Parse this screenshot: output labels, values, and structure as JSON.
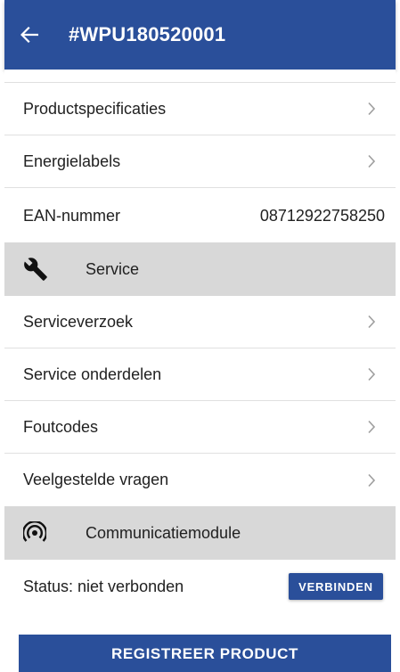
{
  "appbar": {
    "title": "#WPU180520001",
    "back_icon": "arrow-left-icon"
  },
  "product_rows": [
    {
      "label": "Productspecificaties"
    },
    {
      "label": "Energielabels"
    }
  ],
  "ean": {
    "label": "EAN-nummer",
    "value": "08712922758250"
  },
  "service": {
    "title": "Service",
    "icon": "wrench-icon",
    "items": [
      {
        "label": "Serviceverzoek"
      },
      {
        "label": "Service onderdelen"
      },
      {
        "label": "Foutcodes"
      },
      {
        "label": "Veelgestelde vragen"
      }
    ]
  },
  "communication": {
    "title": "Communicatiemodule",
    "icon": "wireless-signal-icon",
    "status_text": "Status: niet verbonden",
    "connect_label": "VERBINDEN"
  },
  "register_label": "REGISTREER PRODUCT",
  "colors": {
    "primary": "#2a4f9a",
    "section_bg": "#d8d8d8",
    "divider": "#e0e0e0"
  }
}
